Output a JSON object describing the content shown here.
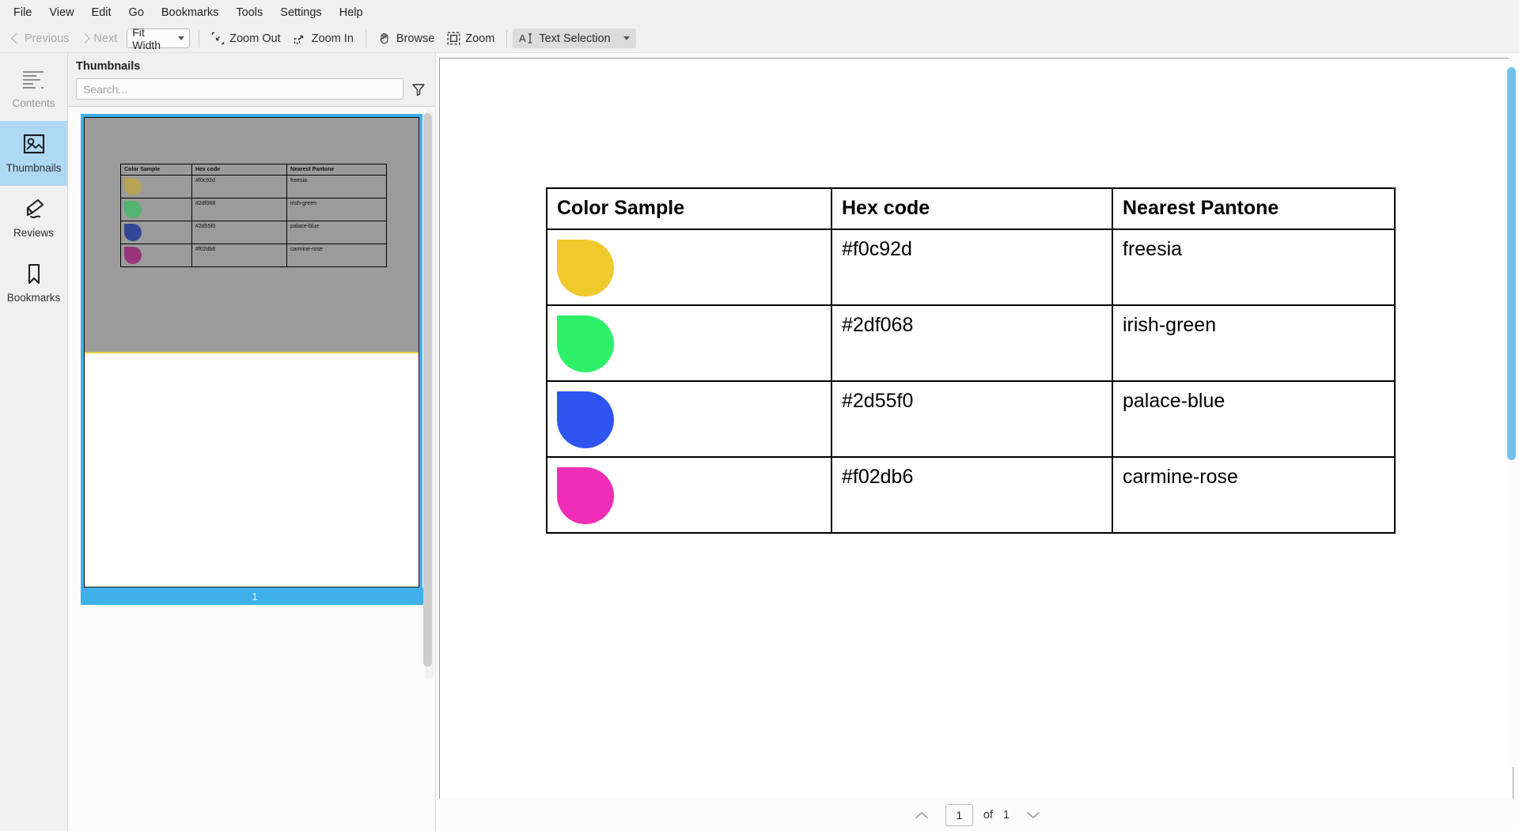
{
  "menubar": {
    "items": [
      {
        "label": "File"
      },
      {
        "label": "View"
      },
      {
        "label": "Edit"
      },
      {
        "label": "Go"
      },
      {
        "label": "Bookmarks"
      },
      {
        "label": "Tools"
      },
      {
        "label": "Settings"
      },
      {
        "label": "Help"
      }
    ]
  },
  "toolbar": {
    "previous_label": "Previous",
    "next_label": "Next",
    "fit_mode": "Fit Width",
    "zoom_out_label": "Zoom Out",
    "zoom_in_label": "Zoom In",
    "browse_label": "Browse",
    "zoom_label": "Zoom",
    "text_selection_label": "Text Selection"
  },
  "rail": {
    "items": [
      {
        "label": "Contents",
        "icon": "contents-icon",
        "state": "disabled"
      },
      {
        "label": "Thumbnails",
        "icon": "thumbnails-icon",
        "state": "selected"
      },
      {
        "label": "Reviews",
        "icon": "reviews-icon",
        "state": "normal"
      },
      {
        "label": "Bookmarks",
        "icon": "bookmarks-icon",
        "state": "normal"
      }
    ]
  },
  "thumbnails_panel": {
    "title": "Thumbnails",
    "search_placeholder": "Search...",
    "search_value": "",
    "filter_icon": "funnel-icon",
    "page_label": "1"
  },
  "document": {
    "table": {
      "headers": [
        "Color Sample",
        "Hex code",
        "Nearest Pantone"
      ],
      "rows": [
        {
          "swatch_color": "#f0c92d",
          "hex": "#f0c92d",
          "pantone": "freesia"
        },
        {
          "swatch_color": "#2df068",
          "hex": "#2df068",
          "pantone": "irish-green"
        },
        {
          "swatch_color": "#2d55f0",
          "hex": "#2d55f0",
          "pantone": "palace-blue"
        },
        {
          "swatch_color": "#f02db6",
          "hex": "#f02db6",
          "pantone": "carmine-rose"
        }
      ]
    }
  },
  "pagenav": {
    "current_page": "1",
    "of_label": "of",
    "total_pages": "1"
  },
  "colors": {
    "accent": "#3fb0e8",
    "rail_selected": "#aed9f4",
    "scroll_thumb": "#74c0ea",
    "chrome": "#f0f0f0"
  }
}
